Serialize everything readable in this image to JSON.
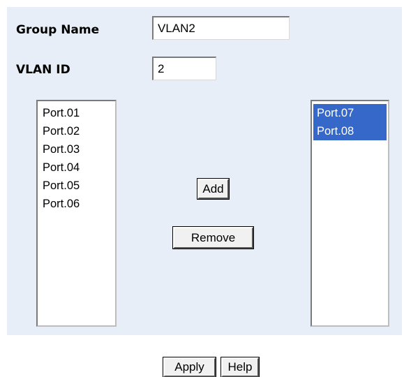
{
  "form": {
    "group_name_label": "Group Name",
    "group_name_value": "VLAN2",
    "vlan_id_label": "VLAN ID",
    "vlan_id_value": "2"
  },
  "available_ports": {
    "options": [
      "Port.01",
      "Port.02",
      "Port.03",
      "Port.04",
      "Port.05",
      "Port.06"
    ]
  },
  "member_ports": {
    "options": [
      "Port.07",
      "Port.08"
    ],
    "selected": [
      "Port.07",
      "Port.08"
    ]
  },
  "actions": {
    "add_label": "Add",
    "remove_label": "Remove",
    "apply_label": "Apply",
    "help_label": "Help"
  },
  "colors": {
    "panel_background": "#e7eef7",
    "selection_highlight": "#3568c9"
  }
}
